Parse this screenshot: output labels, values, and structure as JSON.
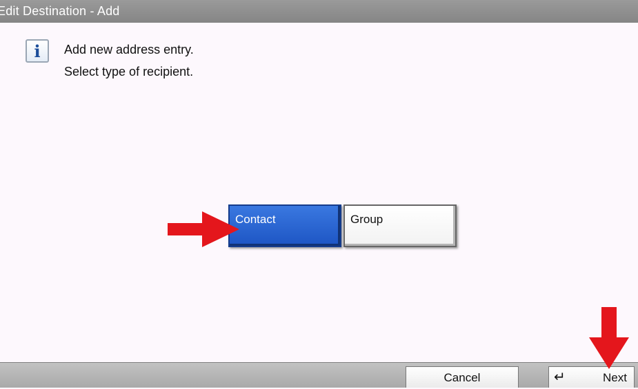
{
  "window": {
    "title": "Edit Destination - Add"
  },
  "message": {
    "icon": "info-icon",
    "line1": "Add new address entry.",
    "line2": "Select type of recipient."
  },
  "recipient_types": {
    "contact_label": "Contact",
    "group_label": "Group",
    "selected": "Contact"
  },
  "footer": {
    "cancel_label": "Cancel",
    "next_label": "Next",
    "next_icon": "enter-icon"
  },
  "annotations": {
    "arrow_color": "#e4161c"
  },
  "colors": {
    "selected_button": "#2a63d2",
    "titlebar": "#8e8e8e"
  }
}
